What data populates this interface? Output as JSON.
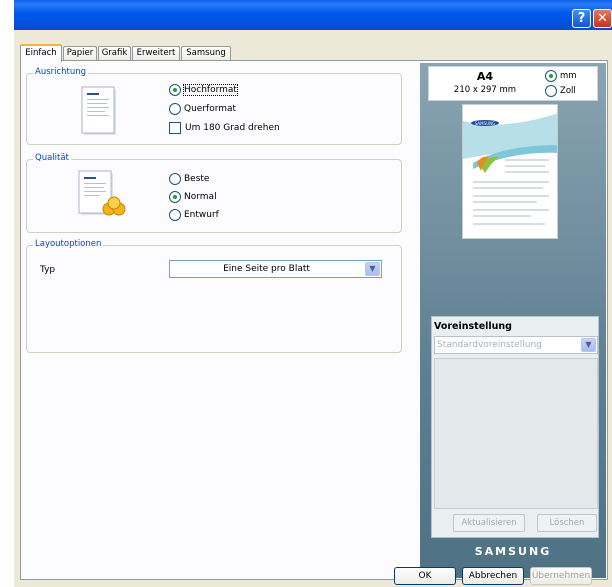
{
  "titlebar": {
    "help_icon": "question-mark",
    "close_icon": "x-mark"
  },
  "tabs": [
    {
      "label": "Einfach",
      "active": true
    },
    {
      "label": "Papier",
      "active": false
    },
    {
      "label": "Grafik",
      "active": false
    },
    {
      "label": "Erweitert",
      "active": false
    },
    {
      "label": "Samsung",
      "active": false
    }
  ],
  "orientation": {
    "title": "Ausrichtung",
    "portrait": "Hochformat",
    "landscape": "Querformat",
    "rotate": "Um 180 Grad drehen",
    "selected": "portrait",
    "rotate_checked": false
  },
  "quality": {
    "title": "Qualität",
    "best": "Beste",
    "normal": "Normal",
    "draft": "Entwurf",
    "selected": "normal"
  },
  "layout": {
    "title": "Layoutoptionen",
    "type_label": "Typ",
    "type_value": "Eine Seite pro Blatt"
  },
  "paper": {
    "name": "A4",
    "dimensions": "210 x 297 mm",
    "unit_mm": "mm",
    "unit_inch": "Zoll",
    "unit_selected": "mm",
    "preview_logo": "SAMSUNG"
  },
  "presets": {
    "title": "Voreinstellung",
    "value": "Standardvoreinstellung",
    "update": "Aktualisieren",
    "delete": "Löschen"
  },
  "brand": "SAMSUNG",
  "buttons": {
    "ok": "OK",
    "cancel": "Abbrechen",
    "apply": "Übernehmen"
  },
  "colors": {
    "titlebar": "#0058ee",
    "group_title": "#0046d5",
    "tab_highlight": "#f6b33f",
    "preview_panel": "#5d7f91"
  }
}
